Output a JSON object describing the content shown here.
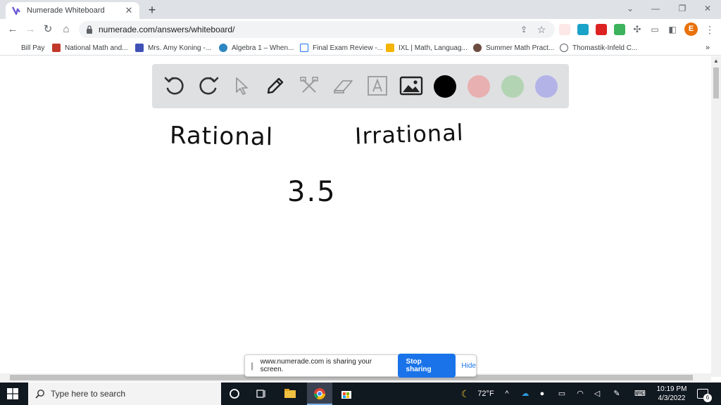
{
  "browser": {
    "tab_title": "Numerade Whiteboard",
    "url": "numerade.com/answers/whiteboard/",
    "profile_initial": "E",
    "bookmarks": [
      "Bill Pay",
      "National Math and...",
      "Mrs. Amy Koning -...",
      "Algebra 1 – When...",
      "Final Exam Review -...",
      "IXL | Math, Languag...",
      "Summer Math Pract...",
      "Thomastik-Infeld C..."
    ],
    "more_bookmarks": "»"
  },
  "whiteboard": {
    "tools": [
      "undo-icon",
      "redo-icon",
      "pointer-icon",
      "pen-icon",
      "tools-icon",
      "eraser-icon",
      "text-icon",
      "image-icon"
    ],
    "colors": [
      "#000000",
      "#e8b0b0",
      "#b3d4b3",
      "#b3b3e8"
    ],
    "handwriting": {
      "left_heading": "Rational",
      "right_heading": "Irrational",
      "value": "3.5"
    }
  },
  "share_banner": {
    "message": "www.numerade.com is sharing your screen.",
    "stop_label": "Stop sharing",
    "hide_label": "Hide"
  },
  "taskbar": {
    "search_placeholder": "Type here to search",
    "weather": "72°F",
    "time": "10:19 PM",
    "date": "4/3/2022",
    "notification_count": "6"
  }
}
